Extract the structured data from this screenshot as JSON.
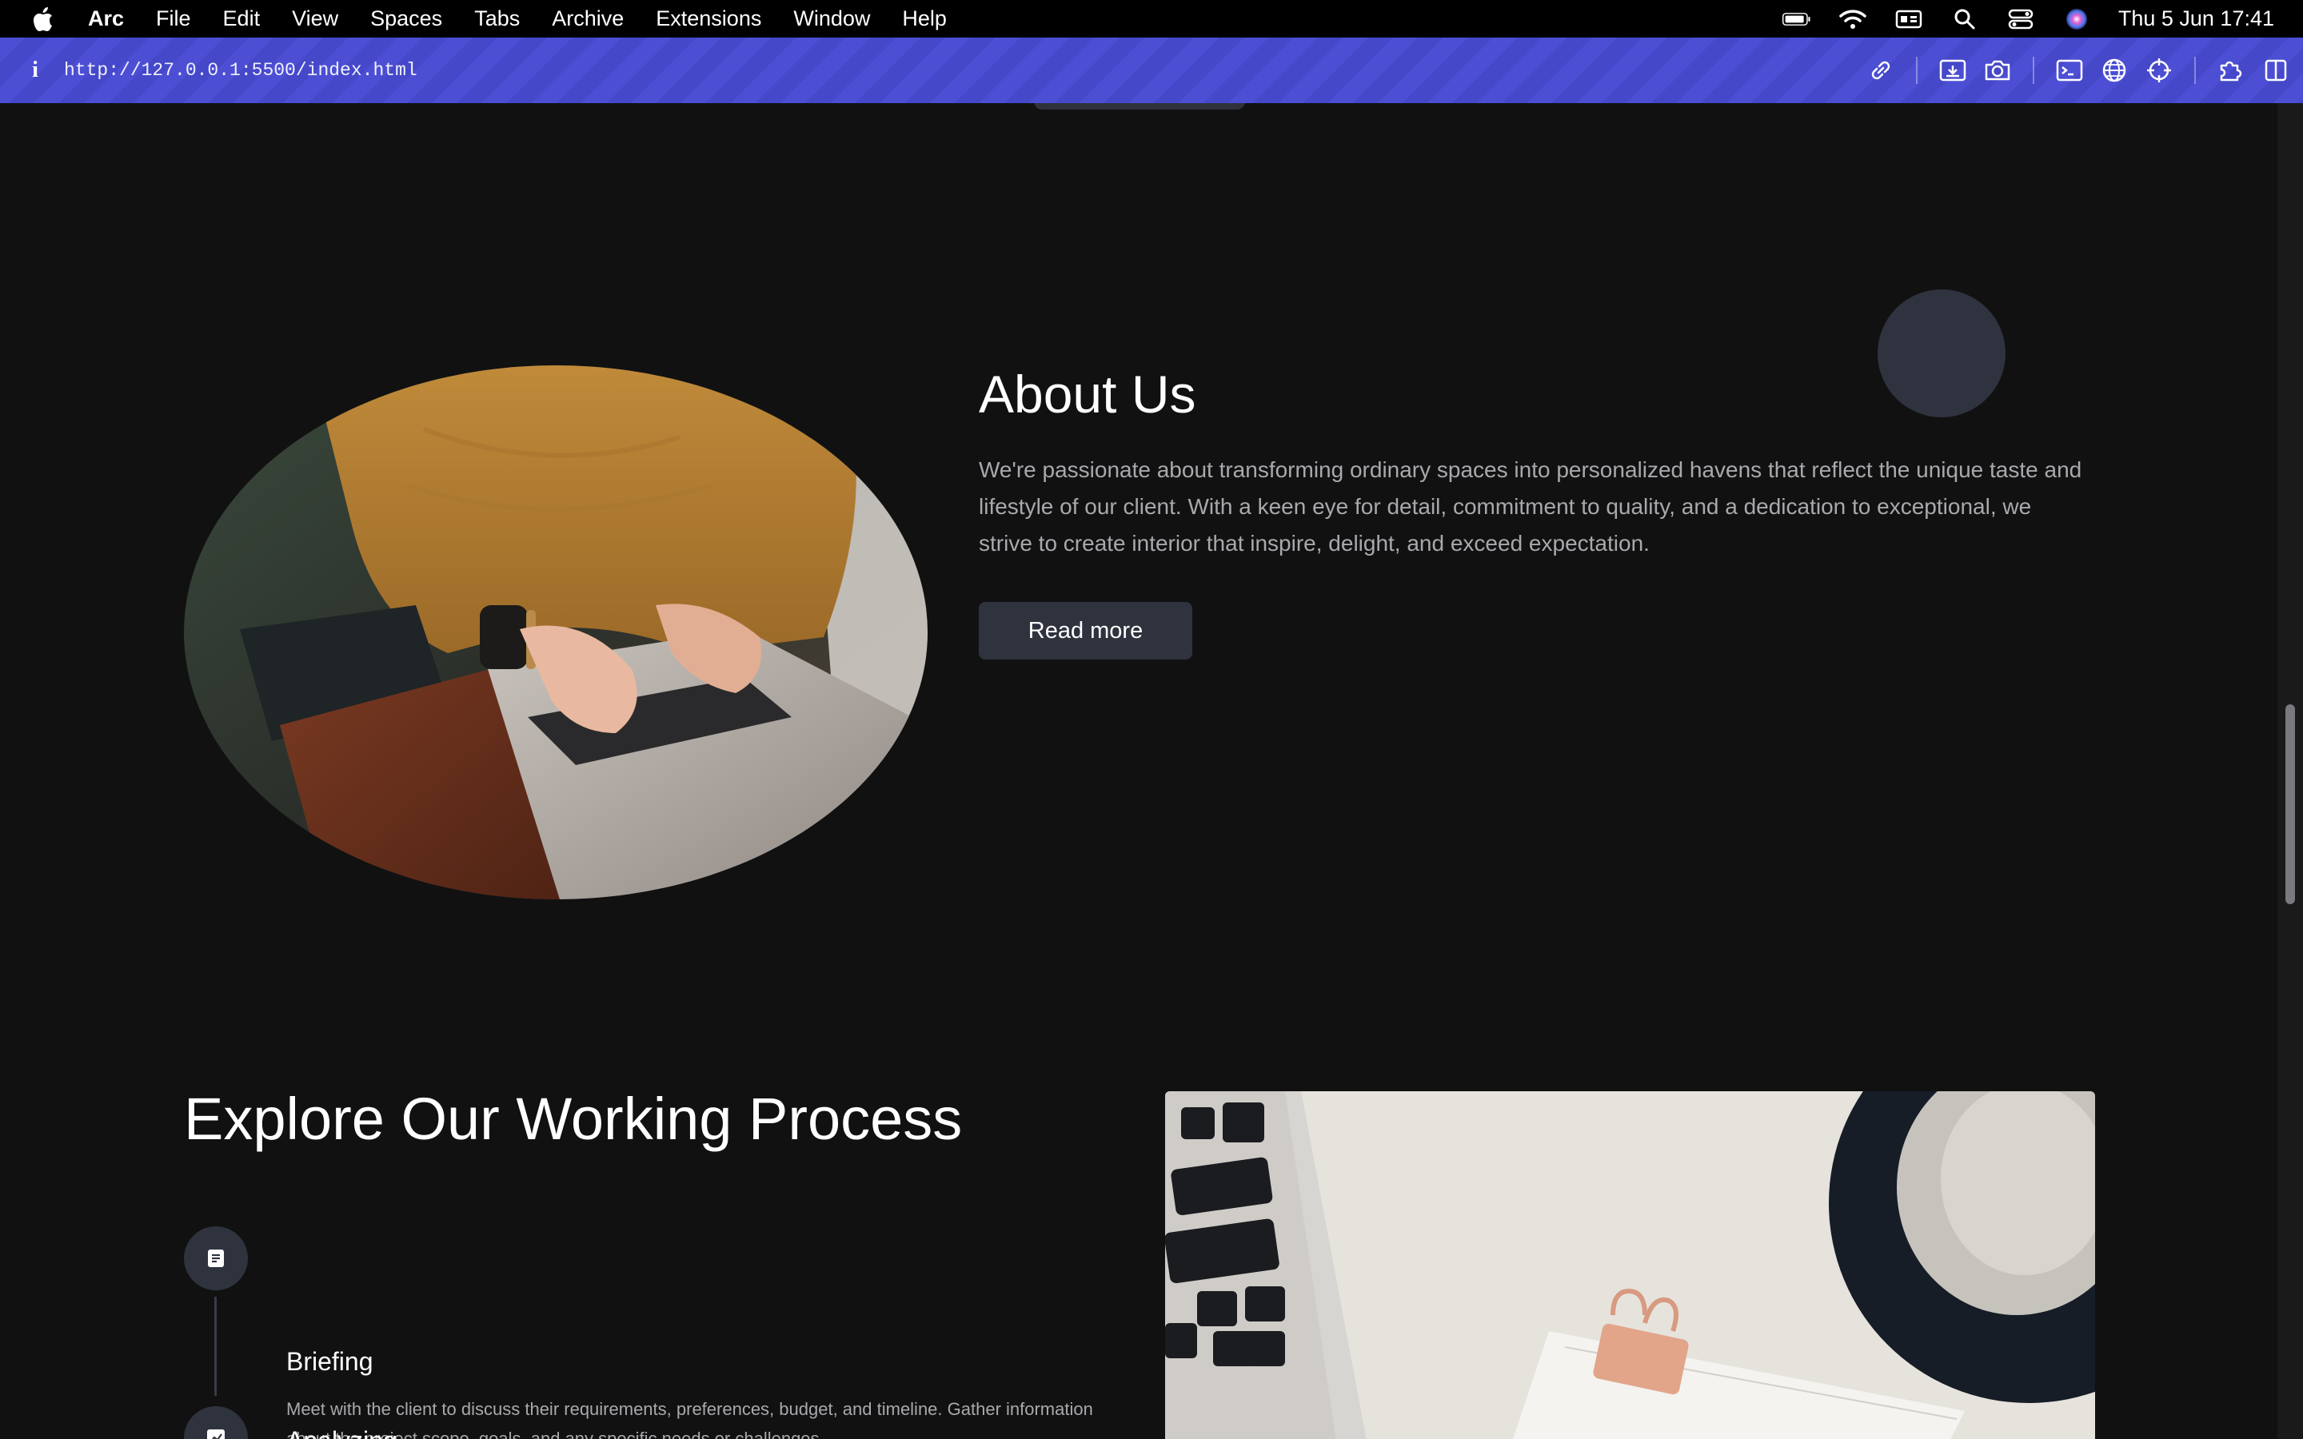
{
  "menubar": {
    "app_name": "Arc",
    "items": [
      "File",
      "Edit",
      "View",
      "Spaces",
      "Tabs",
      "Archive",
      "Extensions",
      "Window",
      "Help"
    ],
    "clock": "Thu 5 Jun  17:41"
  },
  "browser": {
    "url": "http://127.0.0.1:5500/index.html",
    "accent_color": "#4c4fd4"
  },
  "about": {
    "title": "About Us",
    "text": "We're passionate about transforming ordinary spaces into personalized havens that reflect the unique taste and lifestyle of our client. With a keen eye for detail, commitment to quality, and a dedication to exceptional, we strive to create interior that inspire, delight, and exceed expectation.",
    "button_label": "Read more"
  },
  "process": {
    "title": "Explore Our Working Process",
    "steps": [
      {
        "title": "Briefing",
        "description": "Meet with the client to discuss their requirements, preferences, budget, and timeline. Gather information about the project scope, goals, and any specific needs or challenges.",
        "icon": "document-icon"
      },
      {
        "title": "Analyzing",
        "icon": "chart-icon"
      }
    ]
  }
}
